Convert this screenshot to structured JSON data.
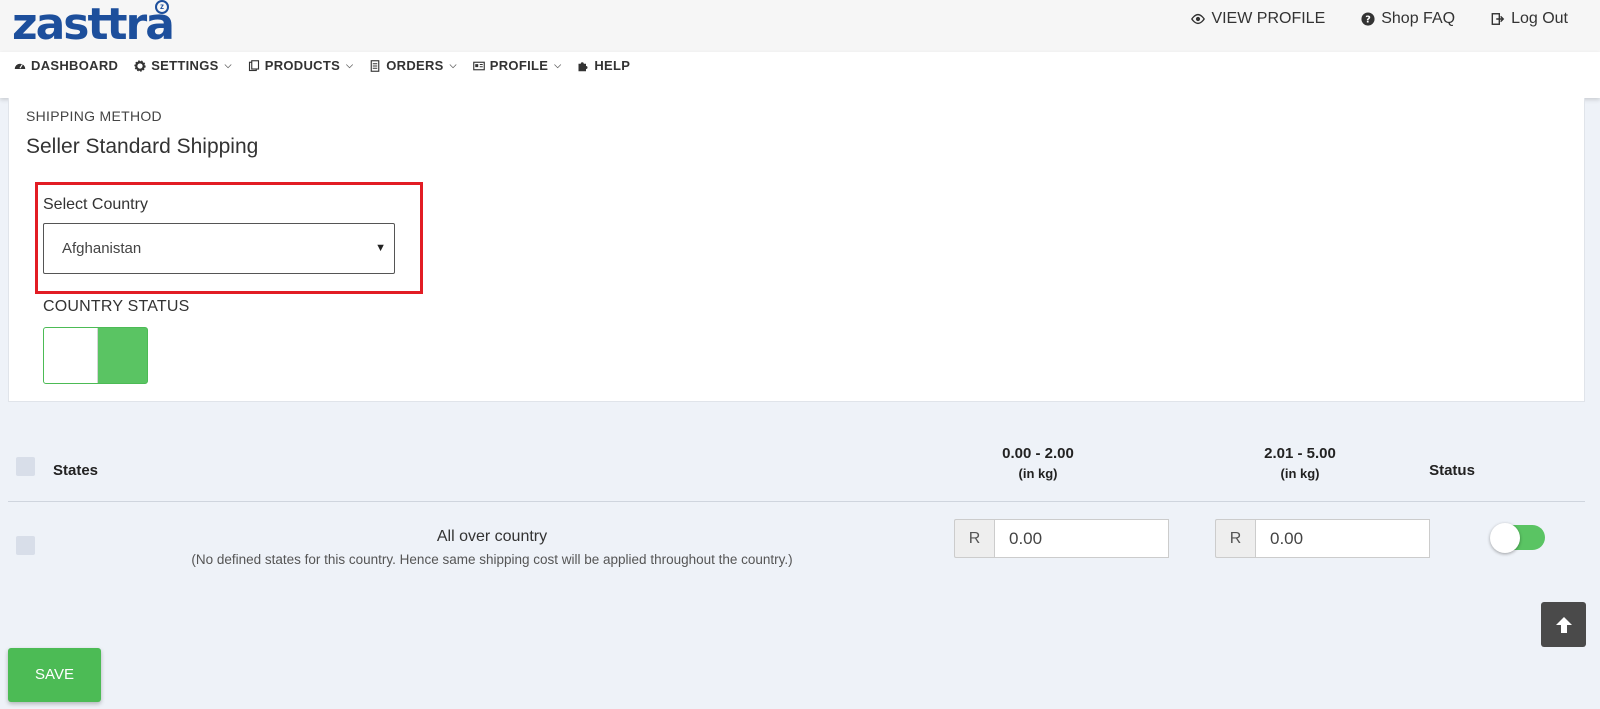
{
  "header": {
    "logo_text": "zasttra",
    "logo_badge": "z",
    "links": [
      {
        "label": "VIEW PROFILE",
        "icon": "eye-icon"
      },
      {
        "label": "Shop FAQ",
        "icon": "question-icon"
      },
      {
        "label": "Log Out",
        "icon": "logout-icon"
      }
    ]
  },
  "nav": [
    {
      "label": "DASHBOARD",
      "icon": "dashboard-icon",
      "dropdown": false
    },
    {
      "label": "SETTINGS",
      "icon": "gear-icon",
      "dropdown": true
    },
    {
      "label": "PRODUCTS",
      "icon": "products-icon",
      "dropdown": true
    },
    {
      "label": "ORDERS",
      "icon": "orders-icon",
      "dropdown": true
    },
    {
      "label": "PROFILE",
      "icon": "profile-icon",
      "dropdown": true
    },
    {
      "label": "HELP",
      "icon": "puzzle-icon",
      "dropdown": false
    }
  ],
  "shipping": {
    "method_label": "SHIPPING METHOD",
    "method_value": "Seller Standard Shipping",
    "country_label": "Select Country",
    "country_selected": "Afghanistan",
    "status_label": "COUNTRY STATUS",
    "status_on": true
  },
  "table": {
    "col_states": "States",
    "col_range1": "0.00 - 2.00",
    "col_range1_unit": "(in kg)",
    "col_range2": "2.01 - 5.00",
    "col_range2_unit": "(in kg)",
    "col_status": "Status",
    "row": {
      "title": "All over country",
      "note": "(No defined states for this country. Hence same shipping cost will be applied throughout the country.)",
      "currency": "R",
      "price1": "0.00",
      "price2": "0.00",
      "status_on": true
    }
  },
  "actions": {
    "save_label": "SAVE",
    "totop_icon": "arrow-up-icon"
  },
  "colors": {
    "brand": "#1d4f9c",
    "accent_green": "#4cbb55",
    "highlight_red": "#e21c24"
  }
}
